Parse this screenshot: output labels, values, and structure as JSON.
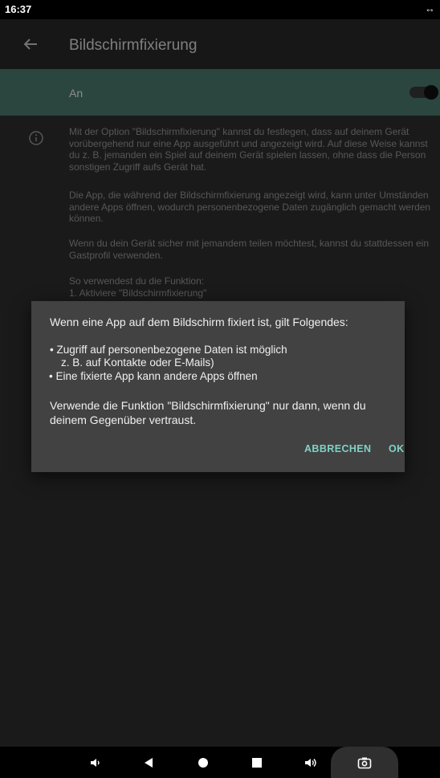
{
  "status_bar": {
    "time": "16:37",
    "right_icon": "↔"
  },
  "app_bar": {
    "title": "Bildschirmfixierung",
    "back_icon": "arrow-back-icon"
  },
  "switch_bar": {
    "label": "An",
    "state": "on"
  },
  "info": {
    "icon": "info-icon",
    "paragraph1": "Mit der Option \"Bildschirmfixierung\" kannst du festlegen, dass auf deinem Gerät vorübergehend nur eine App ausgeführt und angezeigt wird. Auf diese Weise kannst du z. B. jemanden ein Spiel auf deinem Gerät spielen lassen, ohne dass die Person sonstigen Zugriff aufs Gerät hat.",
    "paragraph2": "Die App, die während der Bildschirmfixierung angezeigt wird, kann unter Umständen andere Apps öffnen, wodurch personenbezogene Daten zugänglich gemacht werden können.",
    "paragraph3": "Wenn du dein Gerät sicher mit jemandem teilen möchtest, kannst du stattdessen ein Gastprofil verwenden.",
    "paragraph4_line1": "So verwendest du die Funktion:",
    "paragraph4_line2": "1. Aktiviere \"Bildschirmfixierung\""
  },
  "dialog": {
    "heading": "Wenn eine App auf dem Bildschirm fixiert ist, gilt Folgendes:",
    "bullet1_line1": "•   Zugriff auf personenbezogene Daten ist möglich",
    "bullet1_line2": "z. B. auf Kontakte oder E-Mails)",
    "bullet2": "• Eine fixierte App kann andere Apps öffnen",
    "warning": "Verwende die Funktion \"Bildschirmfixierung\" nur dann, wenn du deinem Gegenüber vertraust.",
    "cancel_label": "ABBRECHEN",
    "ok_label": "OK"
  },
  "nav_bar": {
    "icons": [
      "volume-down-icon",
      "back-triangle-icon",
      "home-circle-icon",
      "recents-square-icon",
      "volume-up-icon",
      "camera-icon"
    ]
  },
  "colors": {
    "accent": "#7fd3c5",
    "switch_bar_bg": "#4f7f74",
    "dialog_bg": "#424242",
    "screen_bg": "#303030"
  }
}
